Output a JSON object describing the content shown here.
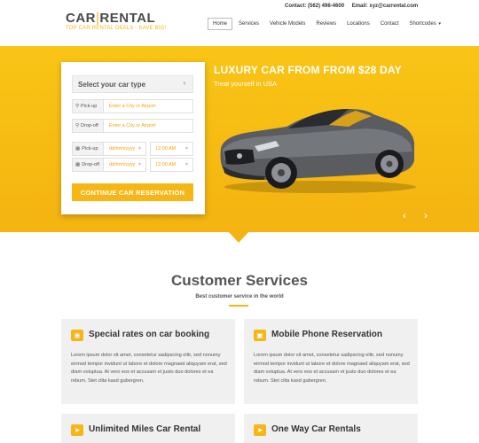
{
  "header": {
    "logo_left": "CAR",
    "logo_bar": "|",
    "logo_right": "RENTAL",
    "tagline": "TOP CAR RENTAL DEALS - SAVE BIG!",
    "contact_phone": "Contact: (562) 498-4600",
    "contact_email": "Email: xyz@carrental.com"
  },
  "nav": {
    "items": [
      {
        "label": "Home",
        "active": true
      },
      {
        "label": "Services"
      },
      {
        "label": "Vehicle Models"
      },
      {
        "label": "Reviews"
      },
      {
        "label": "Locations"
      },
      {
        "label": "Contact"
      },
      {
        "label": "Shortcodes"
      }
    ],
    "dropdown_caret": "▾"
  },
  "booking": {
    "car_type_placeholder": "Select your car type",
    "pickup_label": "Pick-up",
    "pickup_placeholder": "Enter a City or Airport",
    "dropoff_label": "Drop-off",
    "dropoff_placeholder": "Enter a City or Airport",
    "pickup_date_label": "Pick-up",
    "pickup_date": "dd/mm/yyyy",
    "pickup_time": "12:00 AM",
    "dropoff_date_label": "Drop-off",
    "dropoff_date": "dd/mm/yyyy",
    "dropoff_time": "12:00 AM",
    "submit_label": "CONTINUE CAR RESERVATION"
  },
  "hero": {
    "title": "LUXURY CAR FROM FROM $28 DAY",
    "subtitle": "Treat yourself in USA",
    "prev_glyph": "‹",
    "next_glyph": "›"
  },
  "services": {
    "title": "Customer Services",
    "subtitle": "Best customer service in the world",
    "cards": [
      {
        "title": "Special rates on car booking",
        "icon": "tag-icon",
        "body": "Lorem ipsum dolor sit amet, consetetur sadipscing elitr, sed nonumy eirmod tempor invidunt ut labore et dolore magnaed aliquyam erat, sed diam voluptua. At vero eos et accusam et justo duo dolores et ea rebum. Stet clita kasd gubergren."
      },
      {
        "title": "Mobile Phone Reservation",
        "icon": "phone-icon",
        "body": "Lorem ipsum dolor sit amet, consetetur sadipscing elitr, sed nonumy eirmod tempor invidunt ut labore et dolore magnaed aliquyam erat, sed diam voluptua. At vero eos et accusam et justo duo dolores et ea rebum. Stet clita kasd gubergren."
      },
      {
        "title": "Unlimited Miles Car Rental",
        "icon": "road-icon",
        "body": ""
      },
      {
        "title": "One Way Car Rentals",
        "icon": "arrow-icon",
        "body": ""
      }
    ]
  },
  "colors": {
    "accent": "#f6b616",
    "hero_bg": "#f4b311",
    "card_bg": "#f0f0f0"
  }
}
